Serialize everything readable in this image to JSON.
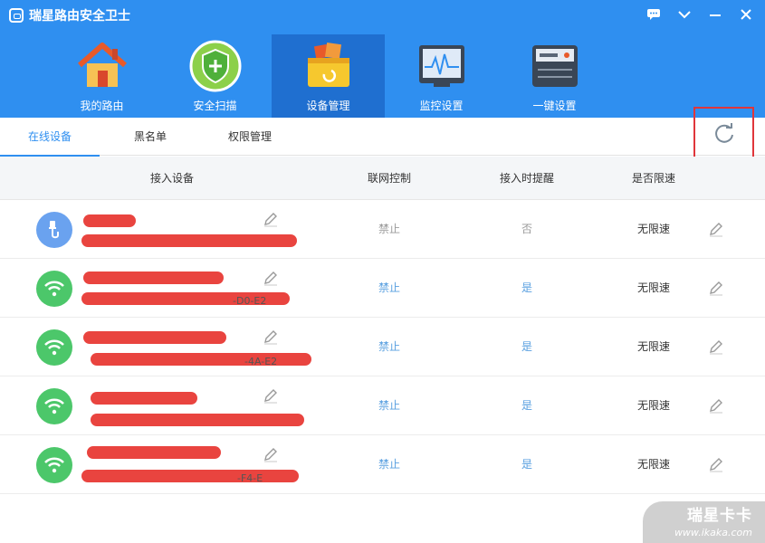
{
  "window": {
    "title": "瑞星路由安全卫士",
    "controls": [
      "chat-icon",
      "chevron-down-icon",
      "minimize-icon",
      "close-icon"
    ]
  },
  "nav": {
    "items": [
      {
        "label": "我的路由",
        "icon": "house-icon"
      },
      {
        "label": "安全扫描",
        "icon": "shield-plus-icon"
      },
      {
        "label": "设备管理",
        "icon": "basket-icon",
        "active": true
      },
      {
        "label": "监控设置",
        "icon": "monitor-chart-icon"
      },
      {
        "label": "一键设置",
        "icon": "router-panel-icon"
      }
    ]
  },
  "tabs": [
    {
      "label": "在线设备",
      "active": true
    },
    {
      "label": "黑名单"
    },
    {
      "label": "权限管理"
    }
  ],
  "table": {
    "headers": [
      "接入设备",
      "联网控制",
      "接入时提醒",
      "是否限速"
    ],
    "rows": [
      {
        "icon": "wired-device-icon",
        "tail": "",
        "control": "禁止",
        "remind": "否",
        "speed": "无限速"
      },
      {
        "icon": "wifi-icon",
        "tail": "-D0-E2",
        "control": "禁止",
        "remind": "是",
        "speed": "无限速"
      },
      {
        "icon": "wifi-icon",
        "tail": "-4A-E2",
        "control": "禁止",
        "remind": "是",
        "speed": "无限速"
      },
      {
        "icon": "wifi-icon",
        "tail": "",
        "control": "禁止",
        "remind": "是",
        "speed": "无限速"
      },
      {
        "icon": "wifi-icon",
        "tail": "-F4-E",
        "control": "禁止",
        "remind": "是",
        "speed": "无限速"
      }
    ]
  },
  "watermark": {
    "brand": "瑞星卡卡",
    "url": "www.ikaka.com"
  },
  "colors": {
    "header": "#2f8ff0",
    "active_nav": "#1f6fd0",
    "accent": "#2f8ff0",
    "redact": "#e9443f",
    "wifi_green": "#4cc76a",
    "wired_blue": "#6aa2ef"
  }
}
